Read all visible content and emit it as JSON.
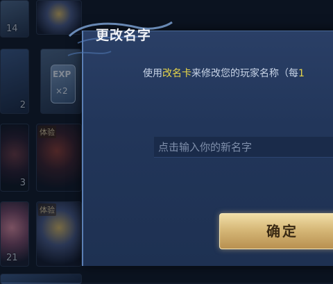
{
  "dialog": {
    "title": "更改名字",
    "desc_prefix": "使用",
    "desc_highlight": "改名卡",
    "desc_suffix": "来修改您的玩家名称（每",
    "desc_trailing": "1",
    "input_placeholder": "点击输入你的新名字",
    "confirm_label": "确定"
  },
  "inventory": {
    "counts": [
      "14",
      "2",
      "3",
      "21"
    ],
    "tags": [
      "体验",
      "体验"
    ],
    "exp_card_label": "EXP",
    "exp_card_multiplier": "×2"
  },
  "colors": {
    "highlight": "#e7d64a",
    "dialog_bg": "#22365a",
    "confirm_gold": "#d6b878"
  }
}
